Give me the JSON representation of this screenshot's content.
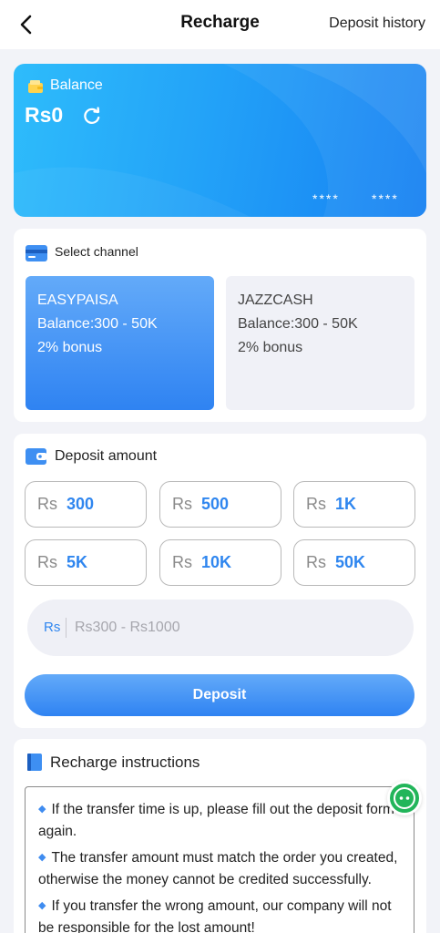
{
  "header": {
    "title": "Recharge",
    "history_label": "Deposit history"
  },
  "balance": {
    "label": "Balance",
    "value": "Rs0",
    "mask_1": "****",
    "mask_2": "****"
  },
  "channel": {
    "title": "Select channel",
    "items": [
      {
        "name": "EASYPAISA",
        "range": "Balance:300 - 50K",
        "bonus": "2% bonus",
        "selected": true
      },
      {
        "name": "JAZZCASH",
        "range": "Balance:300 - 50K",
        "bonus": "2% bonus",
        "selected": false
      }
    ]
  },
  "deposit_amount": {
    "title": "Deposit amount",
    "currency": "Rs",
    "options": [
      "300",
      "500",
      "1K",
      "5K",
      "10K",
      "50K"
    ],
    "input_currency": "Rs",
    "input_placeholder": "Rs300 - Rs1000",
    "input_value": "",
    "button_label": "Deposit"
  },
  "instructions": {
    "title": "Recharge instructions",
    "items": [
      "If the transfer time is up, please fill out the deposit form again.",
      "The transfer amount must match the order you created, otherwise the money cannot be credited successfully.",
      "If you transfer the wrong amount, our company will not be responsible for the lost amount!"
    ]
  },
  "colors": {
    "accent": "#2f86ef",
    "card_gradient_start": "#2ebcfb",
    "card_gradient_end": "#1680f2",
    "chat_green": "#22b55a"
  }
}
